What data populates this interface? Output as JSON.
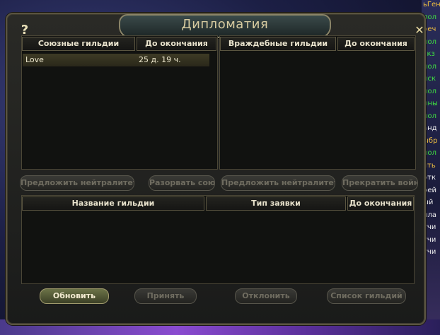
{
  "window": {
    "title": "Дипломатия",
    "help": "?",
    "close": "✕"
  },
  "allied": {
    "col_name": "Союзные гильдии",
    "col_expire": "До окончания",
    "rows": [
      {
        "name": "Love",
        "expire": "25 д. 19 ч."
      }
    ],
    "btn_neutral": "Предложить нейтралитет",
    "btn_break": "Разорвать союз"
  },
  "enemy": {
    "col_name": "Враждебные гильдии",
    "col_expire": "До окончания",
    "btn_neutral": "Предложить нейтралитет",
    "btn_stop": "Прекратить войну"
  },
  "requests": {
    "col_name": "Название гильдии",
    "col_type": "Тип заявки",
    "col_expire": "До окончания"
  },
  "actions": {
    "refresh": "Обновить",
    "accept": "Принять",
    "decline": "Отклонить",
    "guild_list": "Список гильдий"
  },
  "chat": [
    {
      "text": "ьГенер",
      "color": "#f0c040"
    },
    {
      "text": "пол",
      "color": "#40e040"
    },
    {
      "text": "реч",
      "color": "#f0c040"
    },
    {
      "text": "пол",
      "color": "#40e040"
    },
    {
      "text": "экз",
      "color": "#40e040"
    },
    {
      "text": "пол",
      "color": "#40e040"
    },
    {
      "text": "иск",
      "color": "#40e040"
    },
    {
      "text": "пол",
      "color": "#40e040"
    },
    {
      "text": "ины",
      "color": "#40e040"
    },
    {
      "text": "пол",
      "color": "#40e040"
    },
    {
      "text": "анд",
      "color": "#f0f0f0"
    },
    {
      "text": "ыбр",
      "color": "#f0c040"
    },
    {
      "text": "пол",
      "color": "#40e040"
    },
    {
      "text": "ять",
      "color": "#f0c040"
    },
    {
      "text": "отк",
      "color": "#f0f0f0"
    },
    {
      "text": "рей",
      "color": "#f0f0f0"
    },
    {
      "text": "ый",
      "color": "#f0f0f0"
    },
    {
      "text": "ила",
      "color": "#f0f0f0"
    },
    {
      "text": "учи",
      "color": "#f0f0f0"
    },
    {
      "text": "учи",
      "color": "#f0f0f0"
    },
    {
      "text": "учи",
      "color": "#f0f0f0"
    }
  ]
}
